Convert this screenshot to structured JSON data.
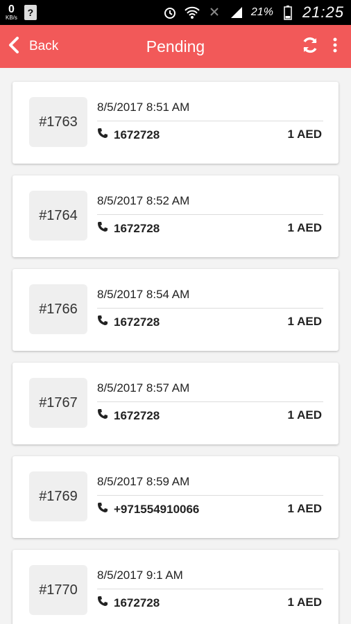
{
  "status_bar": {
    "speed_value": "0",
    "speed_unit": "KB/s",
    "unknown_icon": "?",
    "battery_pct": "21%",
    "time": "21:25"
  },
  "app_bar": {
    "back_label": "Back",
    "title": "Pending",
    "color": "#f25959"
  },
  "orders": [
    {
      "id": "#1763",
      "date": "8/5/2017 8:51 AM",
      "phone": "1672728",
      "amount": "1 AED"
    },
    {
      "id": "#1764",
      "date": "8/5/2017 8:52 AM",
      "phone": "1672728",
      "amount": "1 AED"
    },
    {
      "id": "#1766",
      "date": "8/5/2017 8:54 AM",
      "phone": "1672728",
      "amount": "1 AED"
    },
    {
      "id": "#1767",
      "date": "8/5/2017 8:57 AM",
      "phone": "1672728",
      "amount": "1 AED"
    },
    {
      "id": "#1769",
      "date": "8/5/2017 8:59 AM",
      "phone": "+971554910066",
      "amount": "1 AED"
    },
    {
      "id": "#1770",
      "date": "8/5/2017 9:1 AM",
      "phone": "1672728",
      "amount": "1 AED"
    }
  ]
}
